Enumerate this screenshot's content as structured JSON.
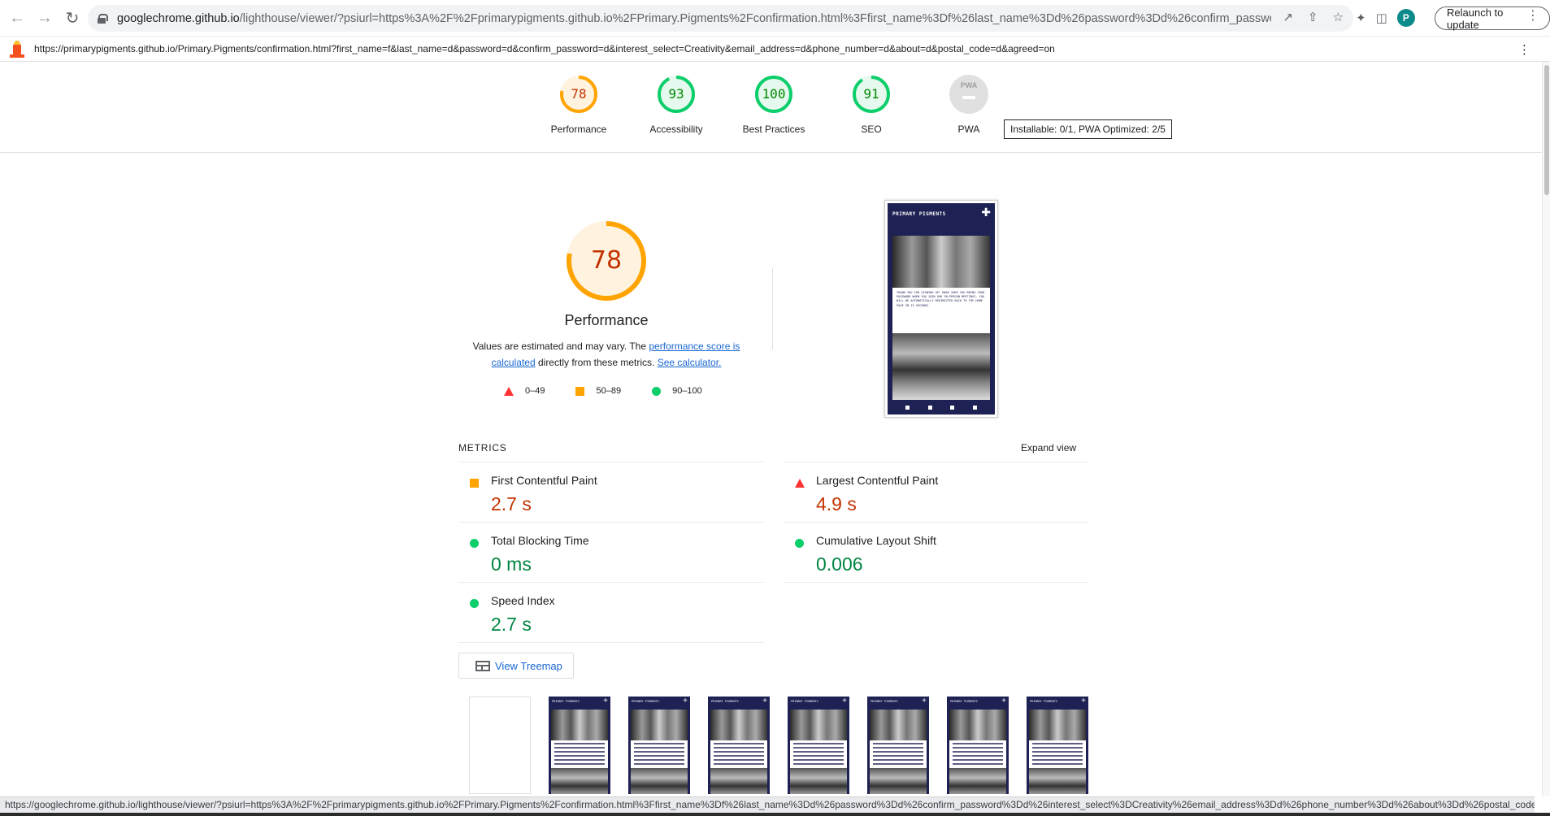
{
  "browser": {
    "url_host": "googlechrome.github.io",
    "url_rest": "/lighthouse/viewer/?psiurl=https%3A%2F%2Fprimarypigments.github.io%2FPrimary.Pigments%2Fconfirmation.html%3Ffirst_name%3Df%26last_name%3Dd%26password%3Dd%26confirm_password%3D...",
    "relaunch_label": "Relaunch to update",
    "avatar_letter": "P",
    "status_url": "https://googlechrome.github.io/lighthouse/viewer/?psiurl=https%3A%2F%2Fprimarypigments.github.io%2FPrimary.Pigments%2Fconfirmation.html%3Ffirst_name%3Df%26last_name%3Dd%26password%3Dd%26confirm_password%3Dd%26interest_select%3DCreativity%26email_address%3Dd%26phone_number%3Dd%26about%3Dd%26postal_code%..."
  },
  "report": {
    "tested_url": "https://primarypigments.github.io/Primary.Pigments/confirmation.html?first_name=f&last_name=d&password=d&confirm_password=d&interest_select=Creativity&email_address=d&phone_number=d&about=d&postal_code=d&agreed=on"
  },
  "scores": [
    {
      "label": "Performance",
      "value": 78,
      "color": "#ffa400",
      "fill": "#fff3e0",
      "text": "#c33300"
    },
    {
      "label": "Accessibility",
      "value": 93,
      "color": "#0cce6b",
      "fill": "#e6f9ee",
      "text": "#008800"
    },
    {
      "label": "Best Practices",
      "value": 100,
      "color": "#0cce6b",
      "fill": "#e6f9ee",
      "text": "#008800"
    },
    {
      "label": "SEO",
      "value": 91,
      "color": "#0cce6b",
      "fill": "#e6f9ee",
      "text": "#008800"
    }
  ],
  "pwa": {
    "label": "PWA",
    "badge_text": "PWA",
    "tooltip": "Installable: 0/1, PWA Optimized: 2/5"
  },
  "performance": {
    "score": 78,
    "title": "Performance",
    "desc_prefix": "Values are estimated and may vary. The ",
    "desc_link": "performance score is calculated",
    "desc_mid": " directly from these metrics. ",
    "desc_link2": "See calculator.",
    "legend": [
      "0–49",
      "50–89",
      "90–100"
    ]
  },
  "phone": {
    "brand": "PRIMARY PIGMENTS",
    "message": "THANK YOU FOR SIGNING UP! MAKE SURE YOU BRING YOUR PASSWORD WHEN YOU JOIN OUR IN-PERSON MEETINGS. YOU WILL BE AUTOMATICALLY REDIRECTED BACK TO THE HOME PAGE IN 15 SECONDS."
  },
  "metrics": {
    "heading": "METRICS",
    "expand_label": "Expand view",
    "items": [
      {
        "name": "First Contentful Paint",
        "value": "2.7 s",
        "status": "average"
      },
      {
        "name": "Largest Contentful Paint",
        "value": "4.9 s",
        "status": "fail"
      },
      {
        "name": "Total Blocking Time",
        "value": "0 ms",
        "status": "pass"
      },
      {
        "name": "Cumulative Layout Shift",
        "value": "0.006",
        "status": "pass"
      },
      {
        "name": "Speed Index",
        "value": "2.7 s",
        "status": "pass"
      }
    ]
  },
  "treemap_label": "View Treemap",
  "filmstrip": {
    "brand": "PRIMARY PIGMENTS"
  }
}
